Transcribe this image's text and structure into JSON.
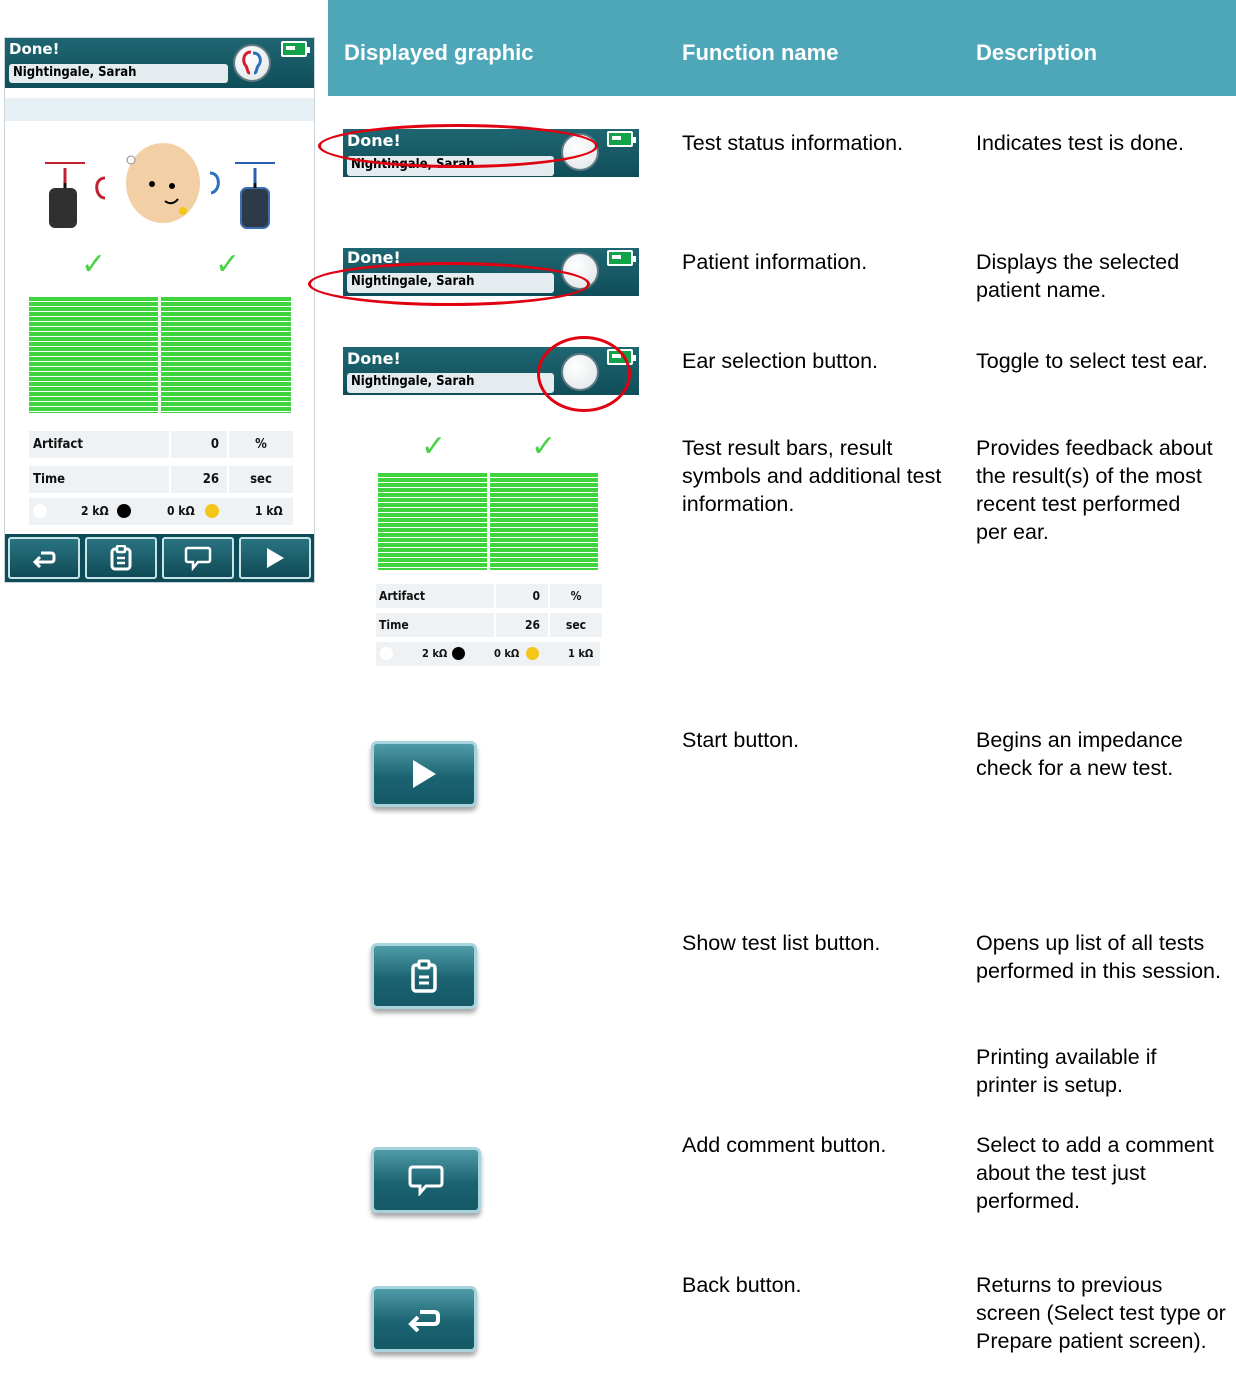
{
  "device": {
    "status": "Done!",
    "patient": "Nightingale, Sarah",
    "artifact_label": "Artifact",
    "artifact_value": "0",
    "artifact_unit": "%",
    "time_label": "Time",
    "time_value": "26",
    "time_unit": "sec",
    "imp_1": "2 kΩ",
    "imp_2": "0 kΩ",
    "imp_3": "1 kΩ"
  },
  "table": {
    "col_graphic": "Displayed graphic",
    "col_function": "Function name",
    "col_description": "Description",
    "rows": [
      {
        "function": "Test status information.",
        "description": "Indicates test is done."
      },
      {
        "function": "Patient information.",
        "description": "Displays the selected patient name."
      },
      {
        "function": "Ear selection button.",
        "description": "Toggle to select test ear."
      },
      {
        "function": "Test result bars, result symbols and additional test information.",
        "description": "Provides feedback about the result(s) of the most recent test performed per ear."
      },
      {
        "function": "Start button.",
        "description": "Begins an impedance check for a new test."
      },
      {
        "function": "Show test list button.",
        "description": "Opens up list of all tests performed in this session."
      },
      {
        "function": "",
        "description": "Printing available if printer is setup."
      },
      {
        "function": "Add comment button.",
        "description": "Select to add a comment about the test just performed."
      },
      {
        "function": "Back button.",
        "description": "Returns to previous screen (Select test type or Prepare patient screen)."
      }
    ]
  },
  "colors": {
    "header": "#4ea6b9",
    "device_bar": "#1a5f6b",
    "pass_green": "#3ed43e",
    "highlight": "#e00010"
  }
}
